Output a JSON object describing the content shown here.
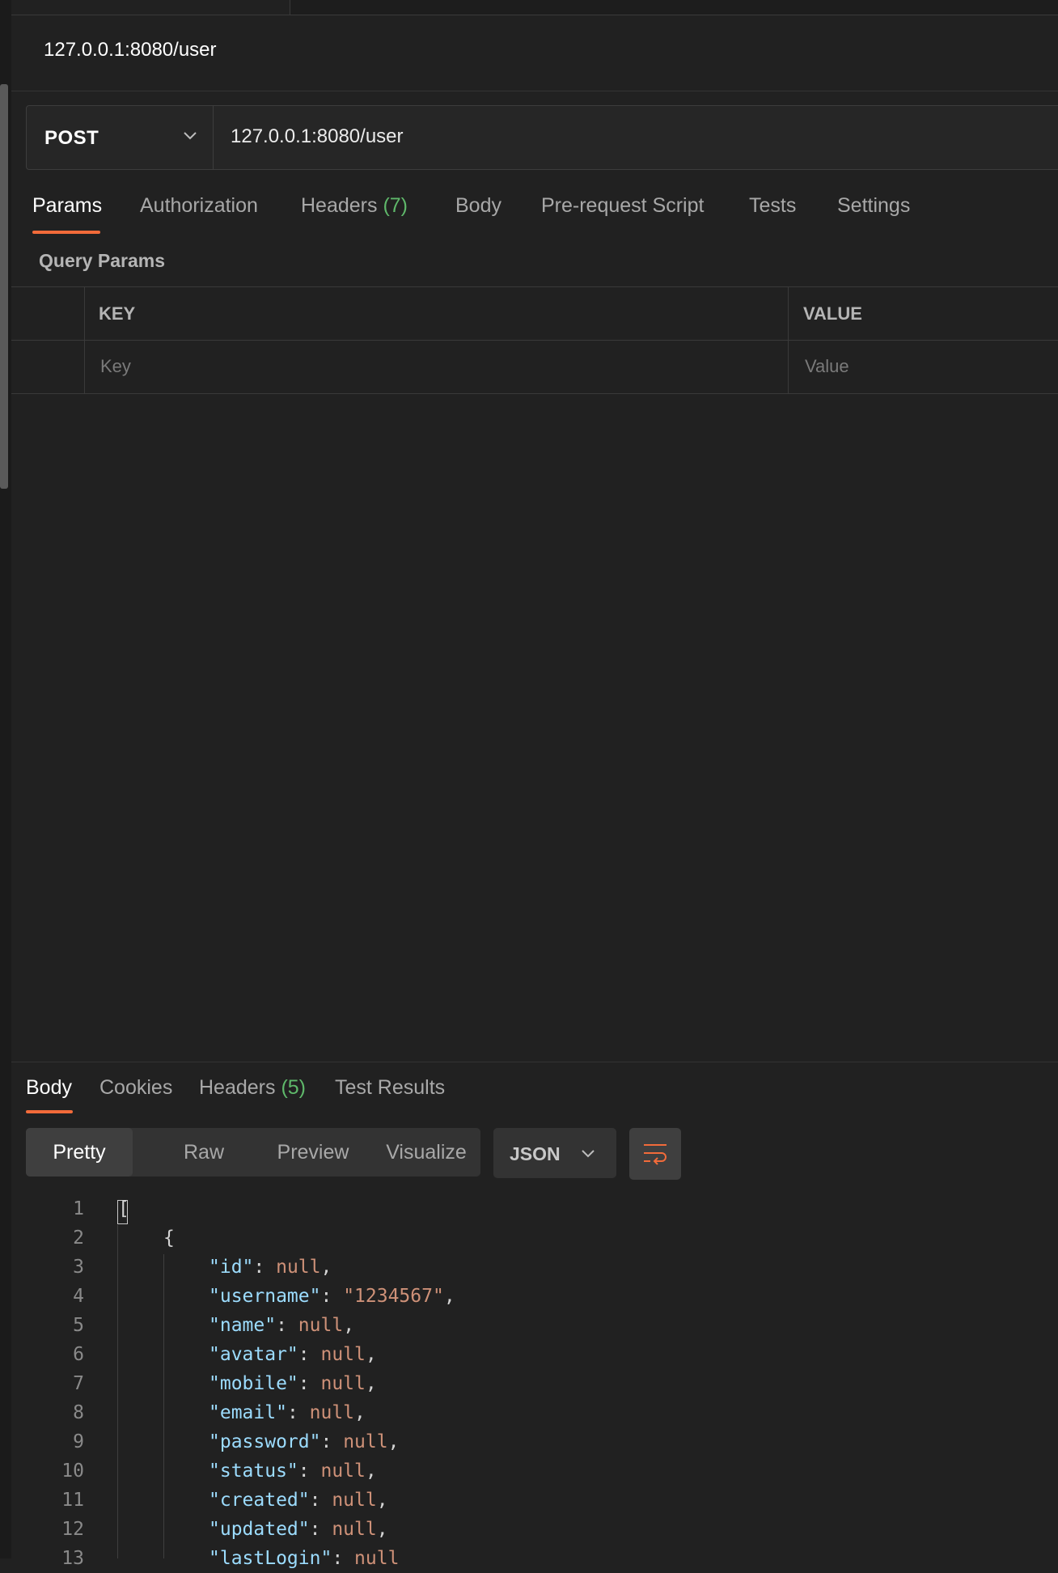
{
  "request": {
    "title": "127.0.0.1:8080/user",
    "method": "POST",
    "url": "127.0.0.1:8080/user"
  },
  "request_tabs": [
    {
      "label": "Params",
      "count": ""
    },
    {
      "label": "Authorization",
      "count": ""
    },
    {
      "label": "Headers",
      "count": "(7)"
    },
    {
      "label": "Body",
      "count": ""
    },
    {
      "label": "Pre-request Script",
      "count": ""
    },
    {
      "label": "Tests",
      "count": ""
    },
    {
      "label": "Settings",
      "count": ""
    }
  ],
  "query_params": {
    "label": "Query Params",
    "key_header": "KEY",
    "value_header": "VALUE",
    "key_placeholder": "Key",
    "value_placeholder": "Value"
  },
  "response_tabs": [
    {
      "label": "Body",
      "count": ""
    },
    {
      "label": "Cookies",
      "count": ""
    },
    {
      "label": "Headers",
      "count": "(5)"
    },
    {
      "label": "Test Results",
      "count": ""
    }
  ],
  "view_modes": [
    "Pretty",
    "Raw",
    "Preview",
    "Visualize"
  ],
  "format": "JSON",
  "icons": {
    "method_dropdown": "chevron-down-icon",
    "format_dropdown": "chevron-down-icon",
    "wrap": "wrap-lines-icon"
  },
  "colors": {
    "accent": "#f26b3a",
    "count": "#5fb86a",
    "json_key": "#9cdcfe",
    "json_value": "#ce9178"
  },
  "code_lines": [
    {
      "n": "1",
      "text": "["
    },
    {
      "n": "2",
      "text": "{"
    },
    {
      "n": "3",
      "key": "\"id\"",
      "value": "null"
    },
    {
      "n": "4",
      "key": "\"username\"",
      "value": "\"1234567\""
    },
    {
      "n": "5",
      "key": "\"name\"",
      "value": "null"
    },
    {
      "n": "6",
      "key": "\"avatar\"",
      "value": "null"
    },
    {
      "n": "7",
      "key": "\"mobile\"",
      "value": "null"
    },
    {
      "n": "8",
      "key": "\"email\"",
      "value": "null"
    },
    {
      "n": "9",
      "key": "\"password\"",
      "value": "null"
    },
    {
      "n": "10",
      "key": "\"status\"",
      "value": "null"
    },
    {
      "n": "11",
      "key": "\"created\"",
      "value": "null"
    },
    {
      "n": "12",
      "key": "\"updated\"",
      "value": "null"
    },
    {
      "n": "13",
      "key": "\"lastLogin\"",
      "value": "null"
    }
  ]
}
